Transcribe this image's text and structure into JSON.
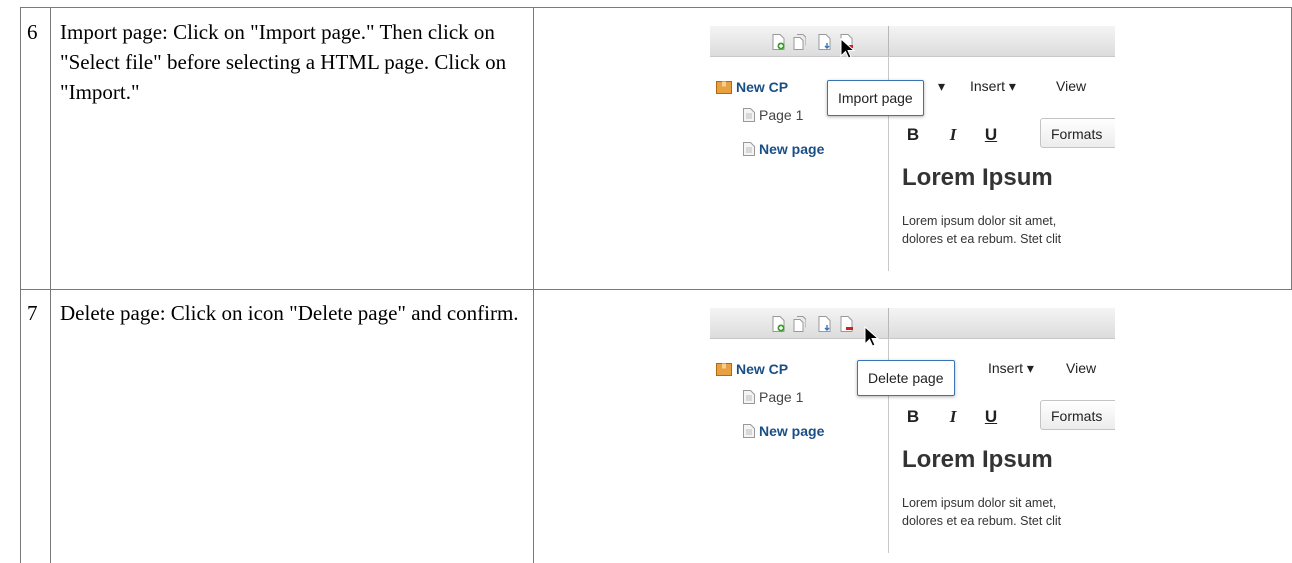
{
  "steps": [
    {
      "number": "6",
      "text": "Import page: Click on \"Import page.\" Then click on \"Select file\" before selecting a HTML page. Click on \"Import.\"",
      "screenshot": {
        "tree": {
          "root": "New CP",
          "page1": "Page 1",
          "new_page": "New page"
        },
        "menu": {
          "insert": "Insert ▾",
          "view": "View"
        },
        "format_buttons": {
          "bold": "B",
          "italic": "I",
          "underline": "U",
          "formats": "Formats"
        },
        "editor": {
          "heading": "Lorem Ipsum",
          "line1": "Lorem ipsum dolor sit amet,",
          "line2": "dolores et ea rebum. Stet clit"
        },
        "tooltip": "Import page",
        "arrow": "▾"
      }
    },
    {
      "number": "7",
      "text": "Delete page: Click on icon \"Delete page\" and confirm.",
      "screenshot": {
        "tree": {
          "root": "New CP",
          "page1": "Page 1",
          "new_page": "New page"
        },
        "menu": {
          "insert": "Insert ▾",
          "view": "View"
        },
        "format_buttons": {
          "bold": "B",
          "italic": "I",
          "underline": "U",
          "formats": "Formats"
        },
        "editor": {
          "heading": "Lorem Ipsum",
          "line1": "Lorem ipsum dolor sit amet,",
          "line2": "dolores et ea rebum. Stet clit"
        },
        "tooltip": "Delete page"
      }
    }
  ],
  "colors": {
    "border": "#7a7a7a",
    "tooltip_border": "#3a74b4",
    "tree_link": "#1a4f86",
    "add_icon": "#3a9a2a",
    "delete_icon": "#d02020"
  }
}
